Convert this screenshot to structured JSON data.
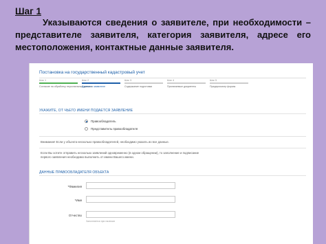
{
  "slide": {
    "step_heading": "Шаг 1",
    "description": "Указываются сведения о заявителе, при необходимости – представителе заявителя, категория заявителя, адресе его местоположения, контактные данные заявителя."
  },
  "form": {
    "title": "Постановка на государственный кадастровый учет",
    "steps": [
      {
        "num": "Шаг 1",
        "label": "Согласие на обработку персональных данных"
      },
      {
        "num": "Шаг 2",
        "label": "Данные о заявителе"
      },
      {
        "num": "Шаг 3",
        "label": "Содержание подготовки"
      },
      {
        "num": "Шаг 4",
        "label": "Прилагаемые документы"
      },
      {
        "num": "Шаг 5",
        "label": "Предпросмотр формы"
      }
    ],
    "applicant_section": "УКАЖИТЕ, ОТ ЧЬЕГО ИМЕНИ ПОДАЕТСЯ ЗАЯВЛЕНИЕ",
    "radio_owner": "Правообладатель",
    "radio_rep": "Представитель правообладателя",
    "note1": "Внимание! Если у объекта несколько правообладателей, необходимо указать их все данные.",
    "note2a": "Если Вы хотите отправить несколько заявлений одновременно (в одном обращении), то заполнение и подписание",
    "note2b": "первого заявления необходимо выполнить от имени Вашего имени.",
    "owner_section": "ДАННЫЕ ПРАВООБЛАДАТЕЛЯ ОБЪЕКТА",
    "fields": {
      "surname_label": "*Фамилия",
      "name_label": "*Имя",
      "patronymic_label": "Отчество",
      "patronymic_hint": "Заполняется при наличии"
    }
  }
}
